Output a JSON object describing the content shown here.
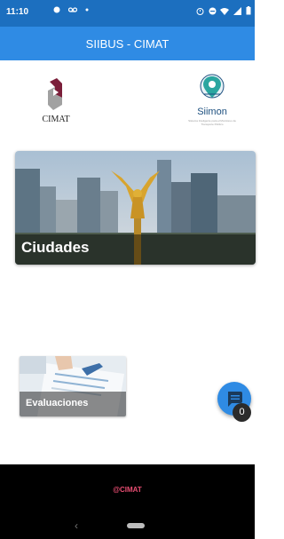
{
  "status_bar": {
    "time": "11:10",
    "left_icons": [
      "notification-icon",
      "voicemail-icon",
      "dot-icon"
    ],
    "right_icons": [
      "alarm-icon",
      "do-not-disturb-icon",
      "wifi-icon",
      "signal-icon",
      "battery-icon"
    ]
  },
  "app_bar": {
    "title": "SIIBUS - CIMAT"
  },
  "logos": {
    "cimat": {
      "label": "CIMAT"
    },
    "siimon": {
      "label": "Siimon",
      "sub": "Sistema Inteligente para el Monitoreo de Transporte Público"
    }
  },
  "cards": [
    {
      "label": "Ciudades"
    },
    {
      "label": "Evaluaciones"
    }
  ],
  "fab": {
    "icon": "chat-icon",
    "badge": "0"
  },
  "footer": {
    "copyright": "@CIMAT"
  },
  "nav": {
    "back_glyph": "‹"
  },
  "colors": {
    "status_bar": "#1c6fbf",
    "app_bar": "#2f8be4",
    "fab": "#2f8be4",
    "footer_text": "#e84d72"
  }
}
